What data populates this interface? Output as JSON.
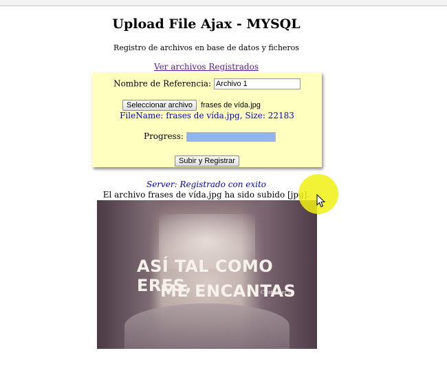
{
  "page": {
    "title": "Upload File Ajax - MYSQL",
    "subtitle": "Registro de archivos en base de datos y ficheros",
    "link_label": "Ver archivos Registrados"
  },
  "form": {
    "reference_label": "Nombre de Referencia:",
    "reference_value": "Archivo 1",
    "select_button": "Seleccionar archivo",
    "selected_file": "frases de vída.jpg",
    "file_info": "FileName: frases de vída.jpg, Size: 22183",
    "progress_label": "Progress:",
    "progress_value": 1.0,
    "submit_button": "Subir y Registrar"
  },
  "result": {
    "server_message": "Server: Registrado con exito",
    "status_message": "El archivo frases de vída.jpg ha sido subido [jpg]."
  },
  "image": {
    "line1": "ASÍ TAL COMO ERES,",
    "line2": "ME ENCANTAS",
    "signature": "Cristopher Dj"
  },
  "icons": {
    "cursor": "mouse-pointer-icon"
  },
  "colors": {
    "panel_bg": "#ffffc0",
    "progress_fill": "#8fb4ee",
    "server_text": "#0000cc",
    "link": "#551a8b",
    "cursor_highlight": "#f0f014"
  }
}
